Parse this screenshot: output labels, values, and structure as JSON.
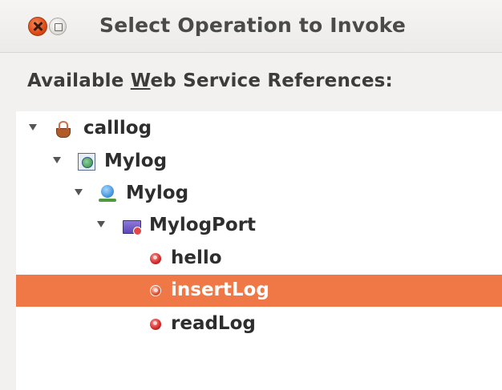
{
  "window": {
    "title": "Select Operation to Invoke"
  },
  "label": {
    "prefix": "Available ",
    "mnemonic": "W",
    "suffix": "eb Service References:"
  },
  "tree": {
    "nodes": [
      {
        "label": "calllog",
        "icon": "coffee-cup-icon",
        "expanded": true
      },
      {
        "label": "Mylog",
        "icon": "wsdl-document-icon",
        "expanded": true
      },
      {
        "label": "Mylog",
        "icon": "web-service-icon",
        "expanded": true
      },
      {
        "label": "MylogPort",
        "icon": "port-folder-icon",
        "expanded": true
      },
      {
        "label": "hello",
        "icon": "operation-icon"
      },
      {
        "label": "insertLog",
        "icon": "operation-icon",
        "selected": true
      },
      {
        "label": "readLog",
        "icon": "operation-icon"
      }
    ]
  },
  "colors": {
    "selection": "#f07846",
    "close_button": "#df4a16"
  }
}
